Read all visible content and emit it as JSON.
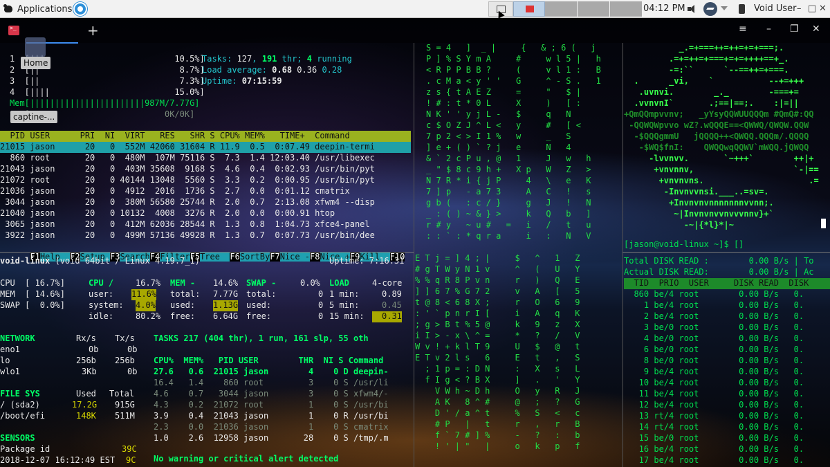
{
  "panel": {
    "applications_label": "Applications",
    "clock": "04:12 PM",
    "user": "Void User",
    "win_min": "–",
    "win_max": "□",
    "win_close": "✕"
  },
  "tooltips": {
    "home": "Home",
    "capture": "captine-..."
  },
  "htop": {
    "cpu_lines": [
      "1  [|||                          10.5%]",
      "2  [||                            8.7%]",
      "3  [||                            7.3%]",
      "4  [||||                         15.0%]",
      "Mem[|||||||||||||||||||||||987M/7.77G]",
      "Swp[                           0K/0K]"
    ],
    "tasks_label": "Tasks: ",
    "tasks_n": "127",
    "thr_n": "191",
    "running_n": "4",
    "load_label": "Load average: ",
    "load1": "0.68",
    "load5": "0.36",
    "load15": "0.28",
    "uptime_label": "Uptime: ",
    "uptime": "07:15:59",
    "header": "  PID USER      PRI  NI  VIRT   RES   SHR S CPU% MEM%   TIME+  Command",
    "rows": [
      "21015 jason      20   0  552M 42060 31604 R 11.9  0.5  0:07.49 deepin-termi",
      "  860 root       20   0  480M  107M 75116 S  7.3  1.4 12:03.40 /usr/libexec",
      "21043 jason      20   0  403M 35608  9168 S  4.6  0.4  0:02.93 /usr/bin/pyt",
      "21072 root       20   0 40144 13048  5560 S  3.3  0.2  0:00.95 /usr/bin/pyt",
      "21036 jason      20   0  4912  2016  1736 S  2.7  0.0  0:01.12 cmatrix",
      " 3044 jason      20   0  380M 56580 25744 R  2.0  0.7  2:13.08 xfwm4 --disp",
      "21040 jason      20   0 10132  4008  3276 R  2.0  0.0  0:00.91 htop",
      " 3065 jason      20   0  412M 62036 28544 R  1.3  0.8  1:04.73 xfce4-panel",
      " 3922 jason      20   0  499M 57136 49928 R  1.3  0.7  0:07.73 /usr/bin/dee"
    ],
    "fkeys": [
      {
        "k": "F1",
        "l": "Help  "
      },
      {
        "k": "F2",
        "l": "Setup "
      },
      {
        "k": "F3",
        "l": "Search"
      },
      {
        "k": "F4",
        "l": "Filter"
      },
      {
        "k": "F5",
        "l": "Tree  "
      },
      {
        "k": "F6",
        "l": "SortBy"
      },
      {
        "k": "F7",
        "l": "Nice -"
      },
      {
        "k": "F8",
        "l": "Nice +"
      },
      {
        "k": "F9",
        "l": "Kill  "
      },
      {
        "k": "F10",
        "l": ""
      }
    ]
  },
  "glances": {
    "host": "void-linux",
    "sys": " (void 64bit / Linux 4.19.7_1)",
    "uptime": "Uptime: 7:16:31",
    "cpu_bar": "CPU  [ 16.7%]",
    "mem_bar": "MEM  [ 14.6%]",
    "swap_bar": "SWAP [  0.0%]",
    "cpu_title": "CPU /",
    "cpu_total": "16.7%",
    "user_label": "user:",
    "user_val": "11.6%",
    "system_label": "system:",
    "system_val": "4.0%",
    "idle_label": "idle:",
    "idle_val": "80.2%",
    "mem_title": "MEM -",
    "mem_pct": "14.6%",
    "mem_total_label": "total:",
    "mem_total": "7.77G",
    "mem_used_label": "used:",
    "mem_used": "1.13G",
    "mem_free_label": "free:",
    "mem_free": "6.64G",
    "swap_title": "SWAP -",
    "swap_pct": "0.0%",
    "swap_total_label": "total:",
    "swap_total": "0",
    "swap_used_label": "used:",
    "swap_used": "0",
    "swap_free_label": "free:",
    "swap_free": "0",
    "load_title": "LOAD",
    "load_cores": "4-core",
    "load_1_label": "1 min:",
    "load_1": "0.89",
    "load_5_label": "5 min:",
    "load_5": "0.45",
    "load_15_label": "15 min:",
    "load_15": "0.31",
    "network_title": "NETWORK",
    "net_rx": "Rx/s",
    "net_tx": "Tx/s",
    "net_rows": [
      {
        "if": "eno1",
        "rx": "0b",
        "tx": "0b"
      },
      {
        "if": "lo",
        "rx": "256b",
        "tx": "256b"
      },
      {
        "if": "wlo1",
        "rx": "3Kb",
        "tx": "0b"
      }
    ],
    "fs_title": "FILE SYS",
    "fs_used": "Used",
    "fs_total": "Total",
    "fs_rows": [
      {
        "m": "/ (sda2)",
        "u": "17.2G",
        "t": "915G"
      },
      {
        "m": "/boot/efi",
        "u": "148K",
        "t": "511M"
      }
    ],
    "sensors_title": "SENSORS",
    "sensor_name": "Package id",
    "sensor_val": "39C",
    "datetime": "2018-12-07 16:12:49 EST",
    "datetime_end": "9C",
    "tasks_line": "TASKS 217 (404 thr), 1 run, 161 slp, 55 oth",
    "proc_header": "CPU%  MEM%   PID USER        THR  NI S Command",
    "proc_rows": [
      "27.6   0.6  21015 jason        4    0 D deepin-",
      "16.4   1.4    860 root         3    0 S /usr/li",
      "4.6    0.7   3044 jason        3    0 S xfwm4/-",
      "4.3    0.2  21072 root         1    0 S /usr/bi",
      "3.9    0.4  21043 jason        1    0 R /usr/bi",
      "2.3    0.0  21036 jason        1    0 S cmatrix",
      "1.0    2.6  12958 jason       28    0 S /tmp/.m"
    ],
    "alert": "No warning or critical alert detected"
  },
  "matrix": {
    "lines": [
      "S = 4   ]  _ |     {   & ; 6 (   j",
      "P ] % S Y m A     #     w l 5 |   h",
      "< R P P B B ?     (     v l 1 :   B",
      ". c M a < y ' '   G     ^ - S .   1",
      "z s { t A E Z     =     \"   $ |",
      "! # : t * 0 L     X     )   [ :",
      "N K ' ' y j L -   $     q   N",
      "c $ O Z J ^ L <   y     #   [ <",
      "7 p 2 < > I 1 %   w     _   S",
      "] e + ( ) ` ? j   e     N   4",
      "& ` 2 c P u , @   1     J   w   h",
      "_ \" $ 8 c 9 h +   X p   W   Z   >",
      "N 7 R * i { j P     4   \\   e   K",
      "7 ] p   - a 7 3     A   C   !   s",
      "g b (   : c / }     g   J   !   N",
      "_ : ( ) ~ & } >     k   Q   b   ]",
      "r # y   ~ u #   =   i   /   t   u",
      ": : ` : * q r a     i   :   N   V"
    ],
    "lower_lines": [
      "E T j = ] 4 ; |     $   ^   1   Z",
      "# g T W y N 1 v     ^   (   U   Y",
      "% % q R 8 P v n     r   )   Q   E",
      "] ] 6 7 % G 7 2     v   A   [   5",
      "t @ 8 < 6 8 X ;     r   O   6   9",
      ": ' ` p n r I [     i   A   q   K",
      "; g > B t % 5 @     k   9   z   X",
      "i I > - x \\ ^ =     *   ?   /   V",
      "W v ! + k l T 9     U   $   @   t",
      "E T v 2 l s   6     E   t   ,   S",
      "  ; 1 p = : D N     :   X   s   L",
      "  f I g < ? B X     ]   .   '   Y",
      "    V W h ~ D h     O   y   R   J",
      "    A K   8 ^ #     @   ;   ?   G",
      "    D ' / a ^ t     %   S   <   c",
      "    # P   |   t     r   ,   r   B",
      "    f ` 7 # ] %     -   ?   :   b",
      "    ! ' | \"   |     o   k   p   f"
    ]
  },
  "ascii": {
    "lines": [
      "           _.=+===++=++=+=+===;.",
      "         .=+=++=+===+=+=++++==+_.",
      "         -=:``      `--==++=+===.",
      "  .      _vi,    `           --+=+++",
      "   .uvnvi.        _._        -===+=",
      "  .vvnvnI`       .;==|==;.    :|=||",
      "+QmQQmpvvnv;   _yYsyQQWUUQQQm #QmQ#:QQ",
      " -QQWQWpvvo wZ?.wQQQE==<QWWQ/QWQW.QQW",
      "  -$QQQgmmU   jQQQQ++<QWQQ.QQQm/.QQQQ",
      "   -$WQ$fnI:    QWQQwqQQWV`mWQQ.jQWQQ",
      "     -lvvnvv.       `~+++`        ++|+",
      "      +vnvnnv,                    `-|==",
      "       +vnvnvns.                     .=",
      "        -Invnvvnsi.___..=sv=.",
      "         +Invnvnvnnnnnnnvvnn;.",
      "          ~|Invnvnvvnvvvnnv}+`",
      "            -~|{*l}*|~"
    ],
    "prompt": "[jason@void-linux ~]$ []"
  },
  "iotop": {
    "total_read": "Total DISK READ :        0.00 B/s | To",
    "actual_read": "Actual DISK READ:        0.00 B/s | Ac",
    "header": "  TID  PRIO  USER     DISK READ  DISK",
    "rows": [
      "  860 be/4 root        0.00 B/s   0.",
      "    1 be/4 root        0.00 B/s   0.",
      "    2 be/4 root        0.00 B/s   0.",
      "    3 be/0 root        0.00 B/s   0.",
      "    4 be/0 root        0.00 B/s   0.",
      "    6 be/0 root        0.00 B/s   0.",
      "    8 be/0 root        0.00 B/s   0.",
      "    9 be/4 root        0.00 B/s   0.",
      "   10 be/4 root        0.00 B/s   0.",
      "   11 be/4 root        0.00 B/s   0.",
      "   12 be/4 root        0.00 B/s   0.",
      "   13 rt/4 root        0.00 B/s   0.",
      "   14 rt/4 root        0.00 B/s   0.",
      "   15 be/0 root        0.00 B/s   0.",
      "   16 be/4 root        0.00 B/s   0.",
      "   17 be/4 root        0.00 B/s   0."
    ]
  }
}
